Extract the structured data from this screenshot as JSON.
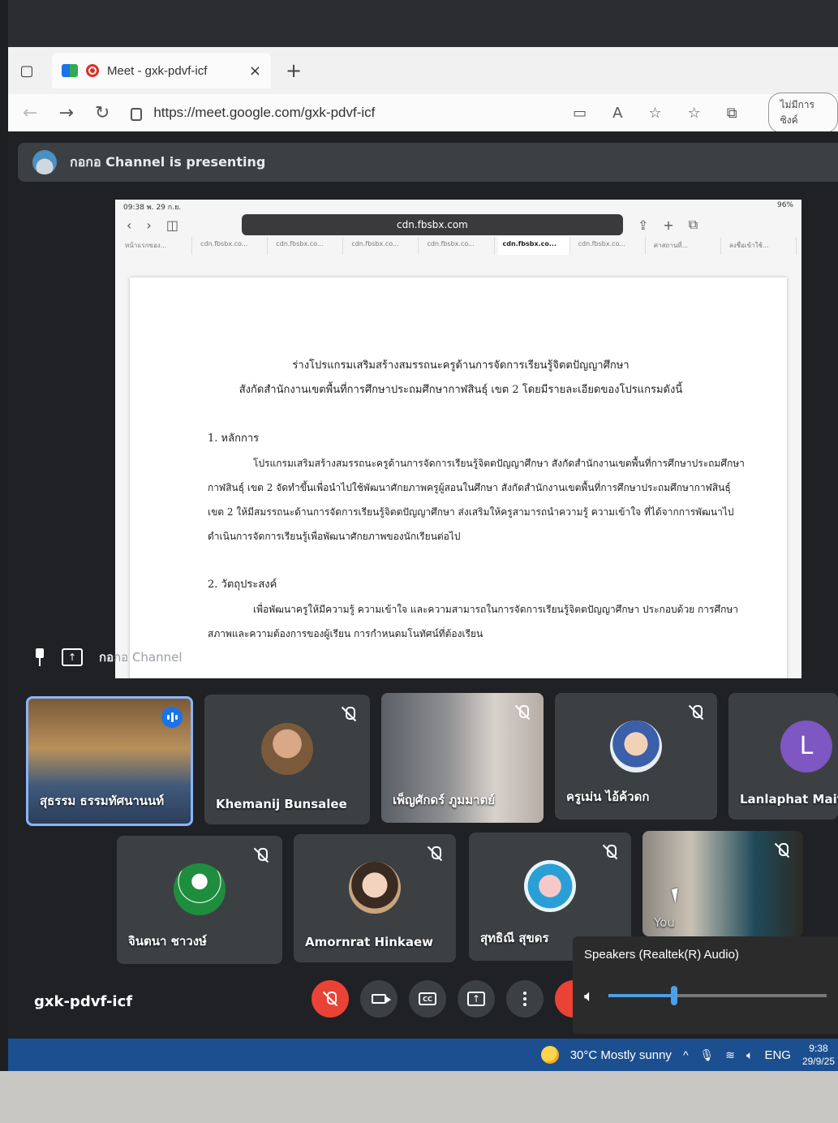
{
  "browser": {
    "tab_title": "Meet - gxk-pdvf-icf",
    "new_tab": "+",
    "url": "https://meet.google.com/gxk-pdvf-icf",
    "sync_label": "ไม่มีการซิงค์",
    "read_aloud": "A"
  },
  "meet": {
    "presenting_text": "กอกอ Channel is presenting",
    "presenter_label_a": "กอ",
    "presenter_label_b": "กอ Channel",
    "meeting_code": "gxk-pdvf-icf"
  },
  "shared": {
    "status_time": "09:38 พ. 29 ก.ย.",
    "status_right": "96%",
    "url": "cdn.fbsbx.com",
    "tabs": [
      "หน้าแรกของ...",
      "cdn.fbsbx.co...",
      "cdn.fbsbx.co...",
      "cdn.fbsbx.co...",
      "cdn.fbsbx.co...",
      "cdn.fbsbx.co...",
      "cdn.fbsbx.co...",
      "ค่าสถานที่...",
      "ลงชื่อเข้าใช้..."
    ],
    "heading1": "ร่างโปรแกรมเสริมสร้างสมรรถนะครูด้านการจัดการเรียนรู้จิตตปัญญาศึกษา",
    "heading2": "สังกัดสำนักงานเขตพื้นที่การศึกษาประถมศึกษากาฬสินธุ์ เขต 2 โดยมีรายละเอียดของโปรแกรมดังนี้",
    "section1": "1. หลักการ",
    "para1": "โปรแกรมเสริมสร้างสมรรถนะครูด้านการจัดการเรียนรู้จิตตปัญญาศึกษา สังกัดสำนักงานเขตพื้นที่การศึกษาประถมศึกษากาฬสินธุ์ เขต 2 จัดทำขึ้นเพื่อนำไปใช้พัฒนาศักยภาพครูผู้สอนในศึกษา สังกัดสำนักงานเขตพื้นที่การศึกษาประถมศึกษากาฬสินธุ์ เขต 2 ให้มีสมรรถนะด้านการจัดการเรียนรู้จิตตปัญญาศึกษา ส่งเสริมให้ครูสามารถนำความรู้ ความเข้าใจ ที่ได้จากการพัฒนาไปดำเนินการจัดการเรียนรู้เพื่อพัฒนาศักยภาพของนักเรียนต่อไป",
    "section2": "2. วัตถุประสงค์",
    "para2": "เพื่อพัฒนาครูให้มีความรู้ ความเข้าใจ และความสามารถในการจัดการเรียนรู้จิตตปัญญาศึกษา ประกอบด้วย การศึกษาสภาพและความต้องการของผู้เรียน การกำหนดมโนทัศน์ที่ต้องเรียน"
  },
  "participants": [
    {
      "name": "สุธรรม ธรรมทัศนานนท์",
      "speaking": true
    },
    {
      "name": "Khemanij Bunsalee",
      "muted": true
    },
    {
      "name": "เพ็ญศักดร์ ภูมมาตย์",
      "muted": true
    },
    {
      "name": "ครูเม่น ไอ้ค้วดก",
      "muted": true
    },
    {
      "name": "Lanlaphat Maitre",
      "initial": "L",
      "muted": true
    },
    {
      "name": "จินตนา ชาวงษ์",
      "muted": true
    },
    {
      "name": "Amornrat Hinkaew",
      "muted": true
    },
    {
      "name": "สุทธิณี สุขดร",
      "muted": true
    },
    {
      "name": "You",
      "muted": true
    }
  ],
  "speakers_popup": {
    "label": "Speakers (Realtek(R) Audio)",
    "volume": 0.3
  },
  "taskbar": {
    "weather": "30°C  Mostly sunny",
    "lang": "ENG",
    "time": "9:38",
    "date": "29/9/25"
  },
  "colors": {
    "meet_bg": "#202124",
    "tile_bg": "#3c4043",
    "end_call": "#ea4335",
    "active_border": "#8ab4f8",
    "taskbar": "#1c4f8f"
  }
}
